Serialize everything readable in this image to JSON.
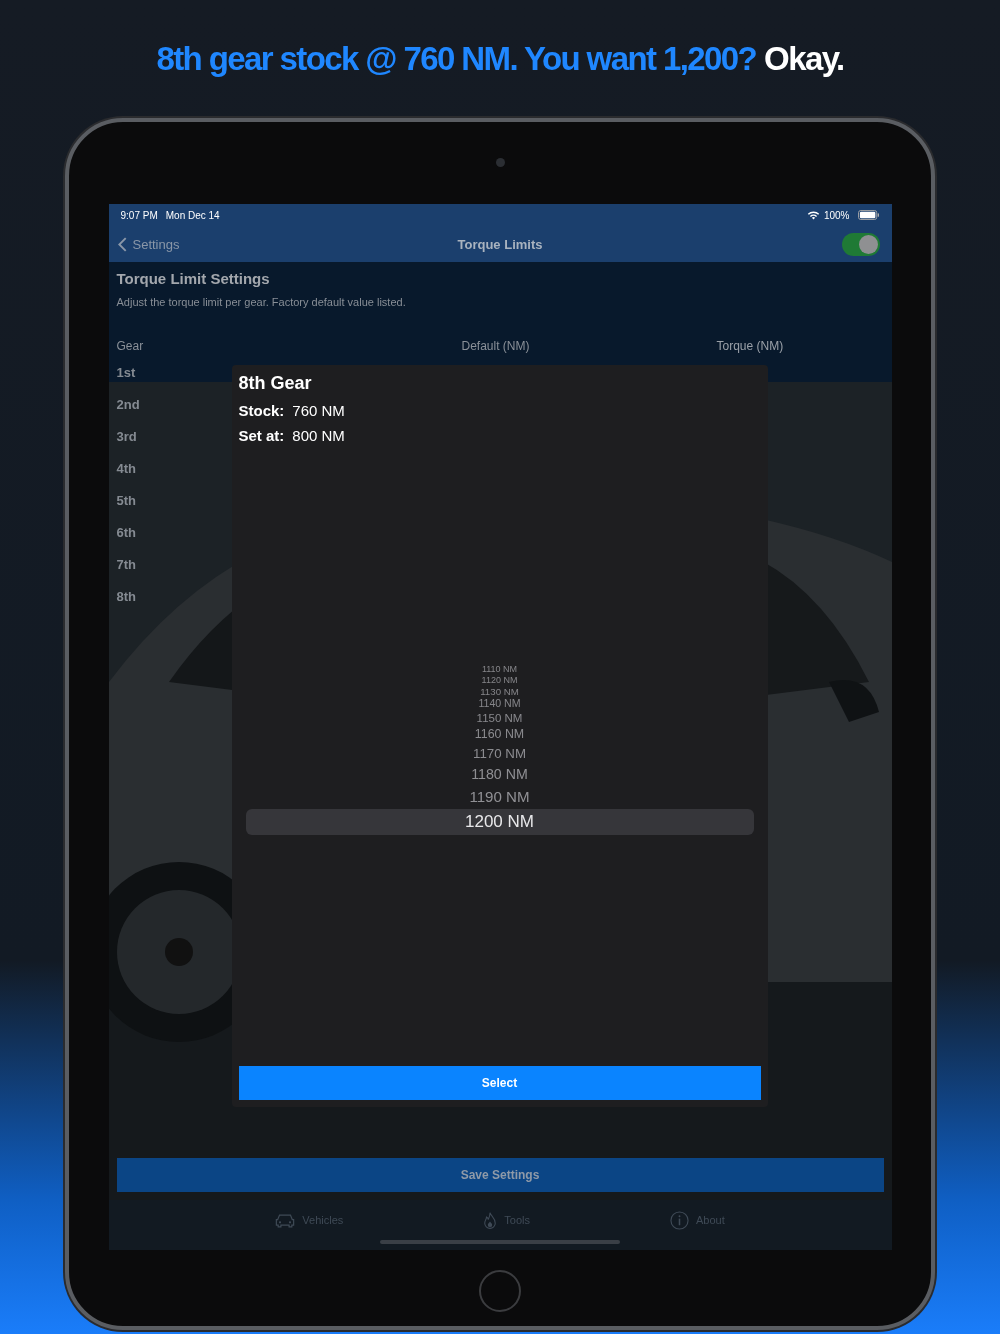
{
  "headline": {
    "text": "8th gear stock @ 760 NM. You want 1,200?",
    "accent": "Okay."
  },
  "status_bar": {
    "time": "9:07 PM",
    "date": "Mon Dec 14",
    "battery": "100%"
  },
  "nav_bar": {
    "back": "Settings",
    "title": "Torque Limits",
    "toggle": {
      "on": true
    }
  },
  "section": {
    "title": "Torque Limit Settings",
    "subtitle": "Adjust the torque limit per gear. Factory default value listed."
  },
  "table": {
    "columns": [
      "Gear",
      "Default (NM)",
      "Torque (NM)"
    ],
    "rows": [
      "1st",
      "2nd",
      "3rd",
      "4th",
      "5th",
      "6th",
      "7th",
      "8th"
    ]
  },
  "dialog": {
    "title": "8th Gear",
    "lines": [
      {
        "label": "Stock:",
        "value": "760 NM"
      },
      {
        "label": "Set at:",
        "value": "800 NM"
      }
    ],
    "picker": [
      {
        "label": "1110 NM",
        "selected": false
      },
      {
        "label": "1120 NM",
        "selected": false
      },
      {
        "label": "1130 NM",
        "selected": false
      },
      {
        "label": "1140 NM",
        "selected": false
      },
      {
        "label": "1150 NM",
        "selected": false
      },
      {
        "label": "1160 NM",
        "selected": false
      },
      {
        "label": "1170 NM",
        "selected": false
      },
      {
        "label": "1180 NM",
        "selected": false
      },
      {
        "label": "1190 NM",
        "selected": false
      },
      {
        "label": "1200 NM",
        "selected": true
      }
    ],
    "button": "Select"
  },
  "save_button": "Save Settings",
  "tabs": [
    {
      "label": "Vehicles",
      "kind": "car",
      "selected": false
    },
    {
      "label": "Tools",
      "kind": "flame",
      "selected": false
    },
    {
      "label": "About",
      "kind": "info",
      "selected": false
    }
  ]
}
